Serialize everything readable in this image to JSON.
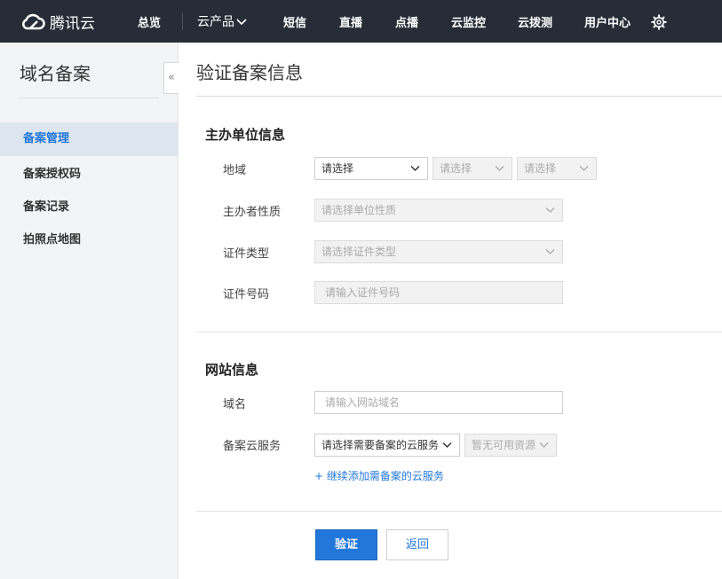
{
  "topbar": {
    "logo_text": "腾讯云",
    "nav": [
      "总览",
      "云产品",
      "短信",
      "直播",
      "点播",
      "云监控",
      "云拨测",
      "用户中心"
    ]
  },
  "sidebar": {
    "title": "域名备案",
    "items": [
      "备案管理",
      "备案授权码",
      "备案记录",
      "拍照点地图"
    ],
    "active_index": 0,
    "collapse_glyph": "«"
  },
  "main": {
    "page_title": "验证备案信息",
    "sponsor_section": {
      "title": "主办单位信息",
      "region_label": "地域",
      "region_selects": [
        "请选择",
        "请选择",
        "请选择"
      ],
      "nature_label": "主办者性质",
      "nature_placeholder": "请选择单位性质",
      "cert_type_label": "证件类型",
      "cert_type_placeholder": "请选择证件类型",
      "cert_no_label": "证件号码",
      "cert_no_placeholder": "请输入证件号码"
    },
    "website_section": {
      "title": "网站信息",
      "domain_label": "域名",
      "domain_placeholder": "请输入网站域名",
      "cloud_label": "备案云服务",
      "cloud_select": "请选择需要备案的云服务",
      "resource_select": "暂无可用资源",
      "add_link": "+ 继续添加需备案的云服务"
    },
    "buttons": {
      "verify": "验证",
      "back": "返回"
    }
  },
  "colors": {
    "accent": "#2277da",
    "topbar": "#262d37",
    "sidebar_bg": "#f2f4f5",
    "active_bg": "#dde6ef"
  }
}
